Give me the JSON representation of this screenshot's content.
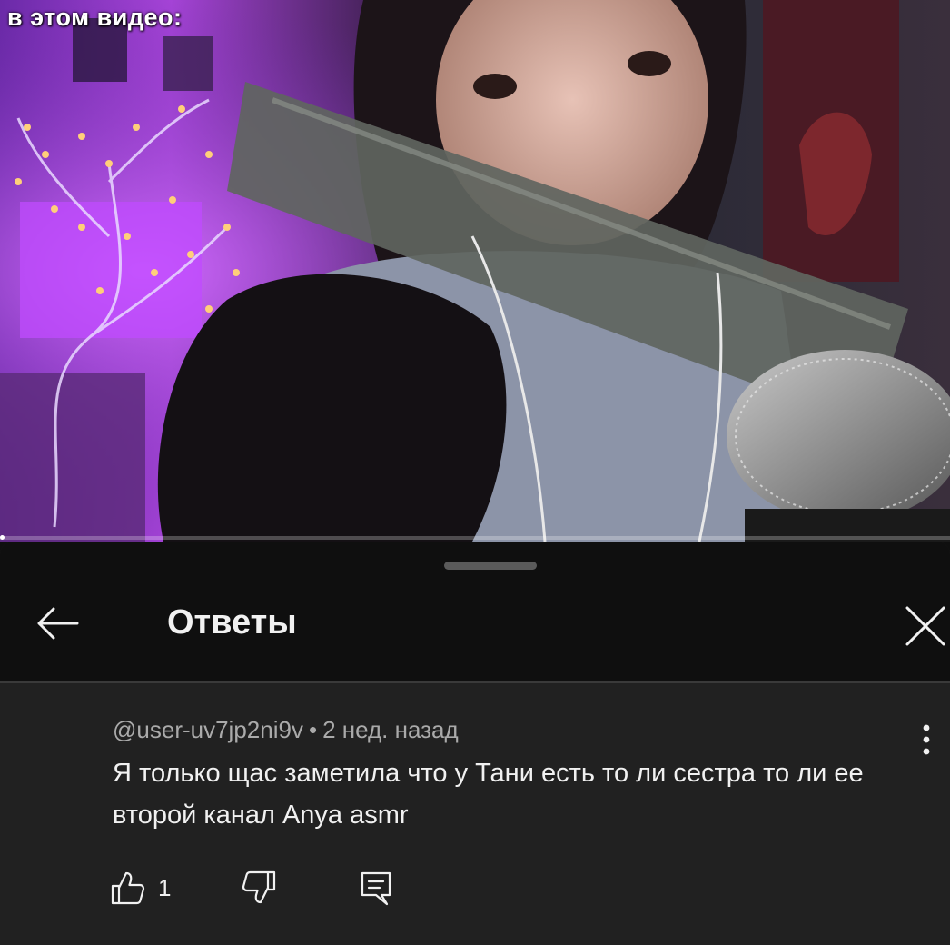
{
  "video": {
    "caption": "в этом видео:"
  },
  "sheet": {
    "title": "Ответы",
    "back_icon": "arrow-left-icon",
    "close_icon": "close-icon"
  },
  "comment": {
    "author": "@user-uv7jp2ni9v",
    "separator": "•",
    "time": "2 нед. назад",
    "text": "Я только щас заметила что у Тани есть то ли сестра то ли ее второй канал Anya asmr",
    "like_count": "1",
    "icons": {
      "like": "thumbs-up-icon",
      "dislike": "thumbs-down-icon",
      "reply": "reply-icon",
      "more": "more-vertical-icon"
    }
  },
  "colors": {
    "sheet_background": "#212121",
    "header_background": "#0f0f0f",
    "primary_text": "#f1f1f1",
    "secondary_text": "#aaaaaa"
  }
}
